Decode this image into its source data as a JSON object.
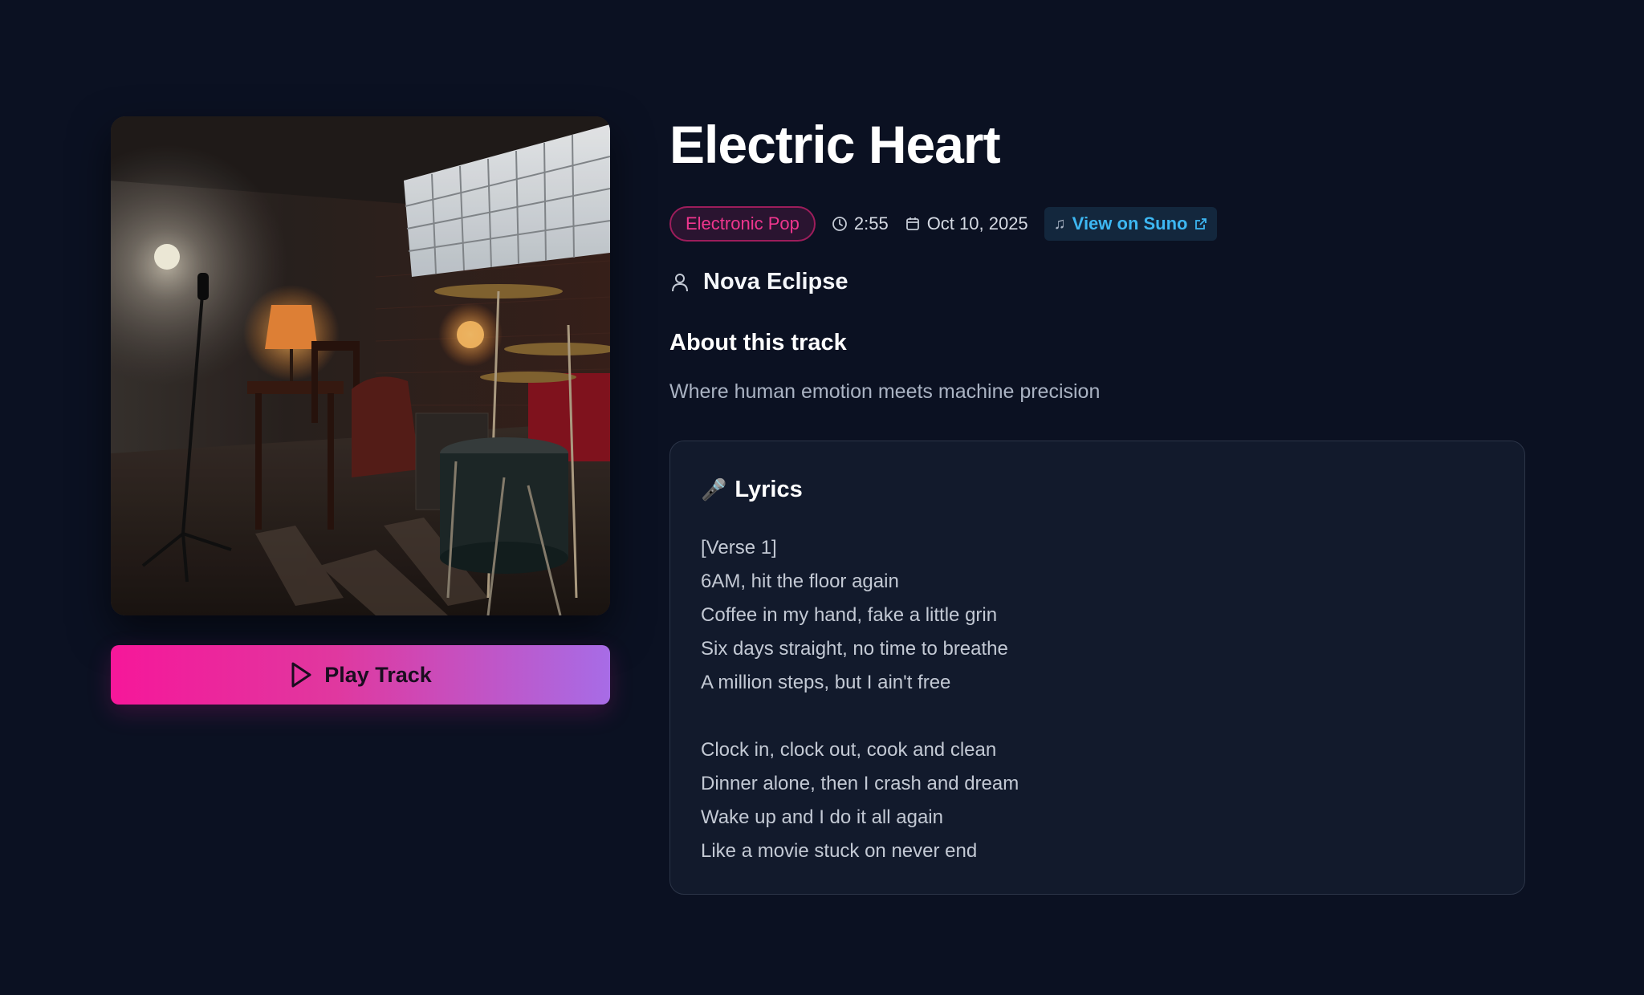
{
  "track": {
    "title": "Electric Heart",
    "genre": "Electronic Pop",
    "duration": "2:55",
    "date": "Oct 10, 2025",
    "suno_link_label": "View on Suno",
    "artist": "Nova Eclipse",
    "about_heading": "About this track",
    "description": "Where human emotion meets machine precision"
  },
  "player": {
    "play_label": "Play Track"
  },
  "lyrics": {
    "heading": "Lyrics",
    "lines": [
      "[Verse 1]",
      "6AM, hit the floor again",
      "Coffee in my hand, fake a little grin",
      "Six days straight, no time to breathe",
      "A million steps, but I ain't free",
      "",
      "Clock in, clock out, cook and clean",
      "Dinner alone, then I crash and dream",
      "Wake up and I do it all again",
      "Like a movie stuck on never end"
    ]
  },
  "icons": {
    "clock": "clock-icon",
    "calendar": "calendar-icon",
    "note": "music-note-icon",
    "external": "external-link-icon",
    "user": "user-icon",
    "mic": "microphone-icon",
    "play": "play-icon"
  },
  "colors": {
    "background": "#0b1122",
    "genre_accent": "#f0368e",
    "link_accent": "#3db7f2",
    "button_gradient_start": "#f6179a",
    "button_gradient_end": "#a76ce6"
  }
}
